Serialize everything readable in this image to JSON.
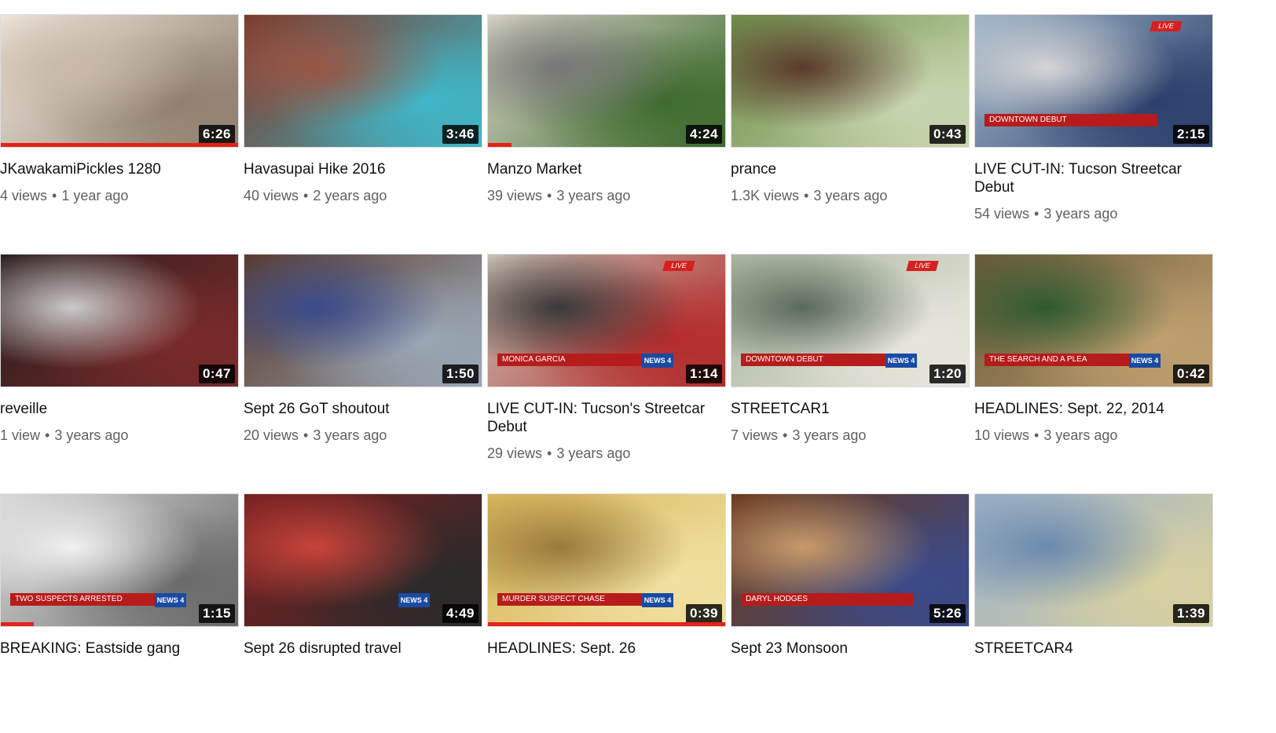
{
  "videos": [
    {
      "title": "JKawakamiPickles 1280",
      "views": "4 views",
      "age": "1 year ago",
      "duration": "6:26",
      "progress": 1.0,
      "colors": [
        "#efe6dc",
        "#8f7f6e",
        "#c9b9a8"
      ]
    },
    {
      "title": "Havasupai Hike 2016",
      "views": "40 views",
      "age": "2 years ago",
      "duration": "3:46",
      "progress": 0,
      "colors": [
        "#7a3a2a",
        "#3fb7c8",
        "#9a5543"
      ]
    },
    {
      "title": "Manzo Market",
      "views": "39 views",
      "age": "3 years ago",
      "duration": "4:24",
      "progress": 0.1,
      "colors": [
        "#d9d4c8",
        "#3d6b2d",
        "#777"
      ]
    },
    {
      "title": "prance",
      "views": "1.3K views",
      "age": "3 years ago",
      "duration": "0:43",
      "progress": 0,
      "colors": [
        "#6f8f4a",
        "#c8d6b0",
        "#5a3a2a"
      ]
    },
    {
      "title": "LIVE CUT-IN: Tucson Streetcar Debut",
      "views": "54 views",
      "age": "3 years ago",
      "duration": "2:15",
      "progress": 0,
      "colors": [
        "#9fb5c8",
        "#2a3f6b",
        "#d5d5d5"
      ],
      "overlay": "DOWNTOWN DEBUT",
      "live": "LIVE"
    },
    {
      "title": "reveille",
      "views": "1 view",
      "age": "3 years ago",
      "duration": "0:47",
      "progress": 0,
      "colors": [
        "#2a1e1e",
        "#7a2a2a",
        "#c9c9c9"
      ]
    },
    {
      "title": "Sept 26 GoT shoutout",
      "views": "20 views",
      "age": "3 years ago",
      "duration": "1:50",
      "progress": 0,
      "colors": [
        "#5b3b2b",
        "#9aa7b5",
        "#3a4a8a"
      ]
    },
    {
      "title": "LIVE CUT-IN: Tucson's Streetcar Debut",
      "views": "29 views",
      "age": "3 years ago",
      "duration": "1:14",
      "progress": 0,
      "colors": [
        "#c8c2b5",
        "#b32a2a",
        "#3a3a3a"
      ],
      "overlay": "MONICA GARCIA",
      "live": "LIVE",
      "news": "NEWS 4"
    },
    {
      "title": "STREETCAR1",
      "views": "7 views",
      "age": "3 years ago",
      "duration": "1:20",
      "progress": 0,
      "colors": [
        "#aab7a0",
        "#e8e6dc",
        "#5a6a5a"
      ],
      "overlay": "DOWNTOWN DEBUT",
      "live": "LIVE",
      "news": "NEWS 4"
    },
    {
      "title": "HEADLINES: Sept. 22, 2014",
      "views": "10 views",
      "age": "3 years ago",
      "duration": "0:42",
      "progress": 0,
      "colors": [
        "#6a5a3a",
        "#c0a070",
        "#2f5a2f"
      ],
      "overlay": "THE SEARCH AND A PLEA",
      "news": "NEWS 4"
    },
    {
      "title": "BREAKING: Eastside gang",
      "views": "",
      "age": "",
      "duration": "1:15",
      "progress": 0.14,
      "colors": [
        "#d8d8d8",
        "#6a6a6a",
        "#f0f0f0"
      ],
      "overlay": "TWO SUSPECTS ARRESTED",
      "news": "NEWS 4"
    },
    {
      "title": "Sept 26 disrupted travel",
      "views": "",
      "age": "",
      "duration": "4:49",
      "progress": 0,
      "colors": [
        "#7a2020",
        "#2a2a2a",
        "#c8433a"
      ],
      "news": "NEWS 4"
    },
    {
      "title": "HEADLINES: Sept. 26",
      "views": "",
      "age": "",
      "duration": "0:39",
      "progress": 1.0,
      "colors": [
        "#d8b65a",
        "#f0e0a0",
        "#9a7a3a"
      ],
      "overlay": "MURDER SUSPECT CHASE",
      "news": "NEWS 4"
    },
    {
      "title": "Sept 23 Monsoon",
      "views": "",
      "age": "",
      "duration": "5:26",
      "progress": 0,
      "colors": [
        "#6a3a1a",
        "#3a4a8a",
        "#c89a6a"
      ],
      "overlay": "DARYL HODGES"
    },
    {
      "title": "STREETCAR4",
      "views": "",
      "age": "",
      "duration": "1:39",
      "progress": 0,
      "colors": [
        "#9ab0c8",
        "#d8d0a0",
        "#6a8ab0"
      ]
    }
  ]
}
